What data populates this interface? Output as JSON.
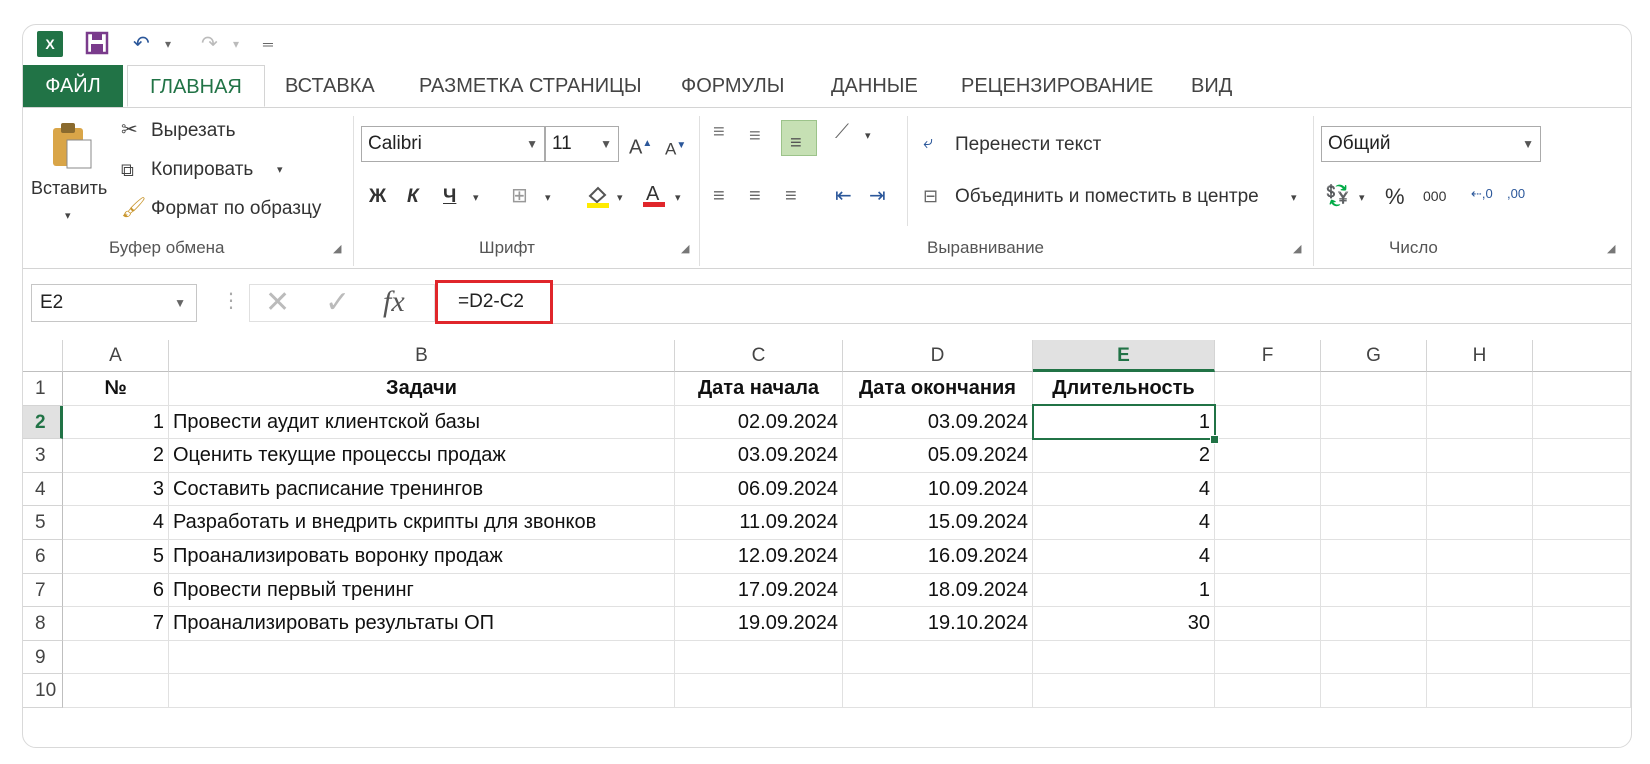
{
  "quick_access": {
    "logo": "X",
    "icons": [
      "save-icon",
      "undo-icon",
      "redo-icon",
      "customize-icon"
    ]
  },
  "tabs": [
    "ФАЙЛ",
    "ГЛАВНАЯ",
    "ВСТАВКА",
    "РАЗМЕТКА СТРАНИЦЫ",
    "ФОРМУЛЫ",
    "ДАННЫЕ",
    "РЕЦЕНЗИРОВАНИЕ",
    "ВИД"
  ],
  "ribbon": {
    "clipboard": {
      "paste": "Вставить",
      "cut": "Вырезать",
      "copy": "Копировать",
      "format_painter": "Формат по образцу",
      "label": "Буфер обмена"
    },
    "font": {
      "name": "Calibri",
      "size": "11",
      "bold": "Ж",
      "italic": "К",
      "underline": "Ч",
      "label": "Шрифт"
    },
    "alignment": {
      "wrap": "Перенести текст",
      "merge": "Объединить и поместить в центре",
      "label": "Выравнивание"
    },
    "number": {
      "format": "Общий",
      "percent": "%",
      "thousands": "000",
      "label": "Число"
    }
  },
  "formula_bar": {
    "name_box": "E2",
    "fx": "fx",
    "formula": "=D2-C2"
  },
  "sheet": {
    "columns": [
      "A",
      "B",
      "C",
      "D",
      "E",
      "F",
      "G",
      "H"
    ],
    "selected_column": "E",
    "selected_row": "2",
    "header": [
      "№",
      "Задачи",
      "Дата начала",
      "Дата окончания",
      "Длительность"
    ],
    "rows": [
      [
        "1",
        "Провести аудит клиентской базы",
        "02.09.2024",
        "03.09.2024",
        "1"
      ],
      [
        "2",
        "Оценить текущие процессы продаж",
        "03.09.2024",
        "05.09.2024",
        "2"
      ],
      [
        "3",
        "Составить расписание тренингов",
        "06.09.2024",
        "10.09.2024",
        "4"
      ],
      [
        "4",
        "Разработать и внедрить скрипты для звонков",
        "11.09.2024",
        "15.09.2024",
        "4"
      ],
      [
        "5",
        "Проанализировать воронку продаж",
        "12.09.2024",
        "16.09.2024",
        "4"
      ],
      [
        "6",
        "Провести первый тренинг",
        "17.09.2024",
        "18.09.2024",
        "1"
      ],
      [
        "7",
        "Проанализировать результаты ОП",
        "19.09.2024",
        "19.10.2024",
        "30"
      ]
    ],
    "row_numbers": [
      "1",
      "2",
      "3",
      "4",
      "5",
      "6",
      "7",
      "8",
      "9",
      "10"
    ]
  },
  "colors": {
    "excel_green": "#217346",
    "highlight_red": "#e0262b"
  }
}
